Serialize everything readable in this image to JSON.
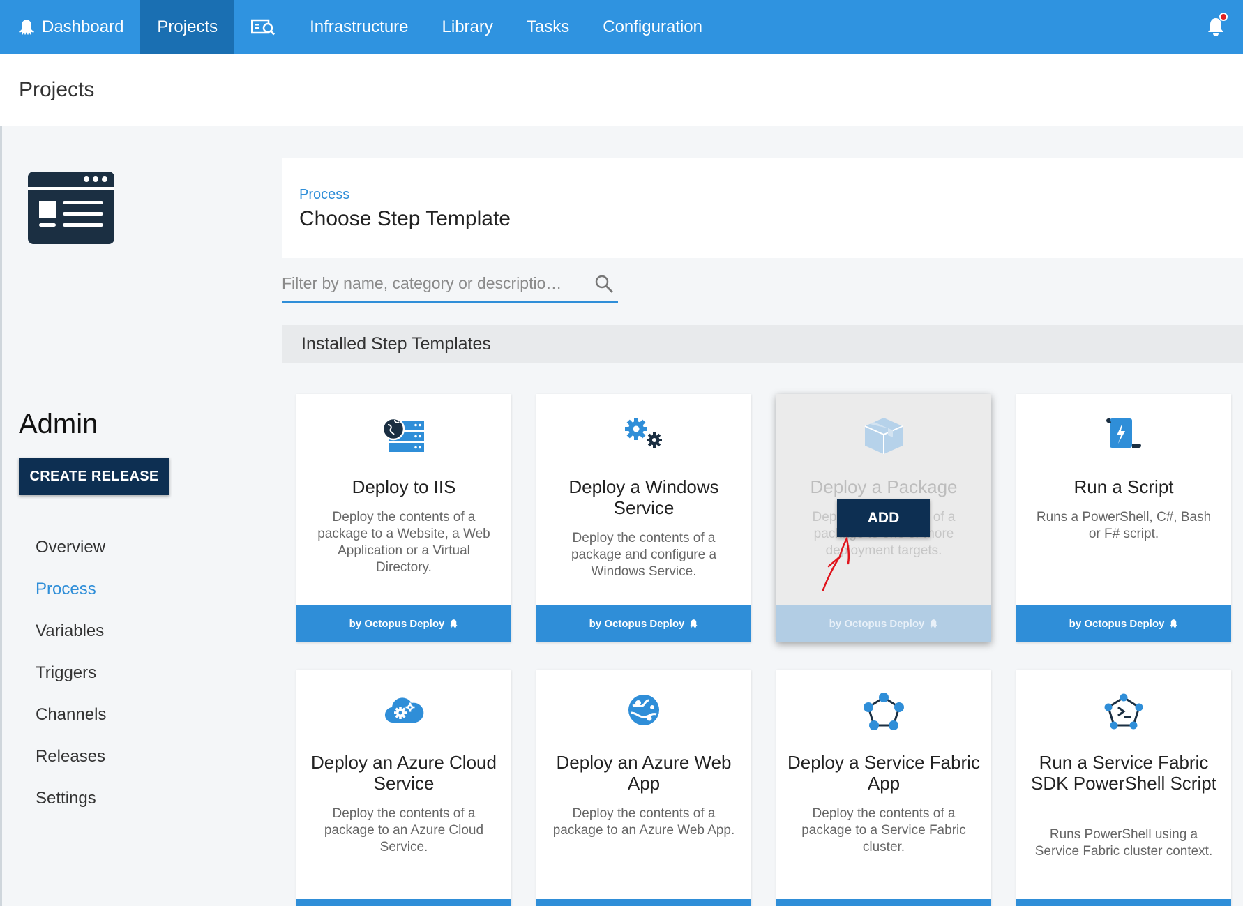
{
  "nav": {
    "brand": "Dashboard",
    "items": [
      "Projects",
      "Infrastructure",
      "Library",
      "Tasks",
      "Configuration"
    ],
    "active": "Projects"
  },
  "header": {
    "title": "Projects"
  },
  "project": {
    "name": "Admin",
    "create_release": "CREATE RELEASE"
  },
  "sidebar": {
    "items": [
      "Overview",
      "Process",
      "Variables",
      "Triggers",
      "Channels",
      "Releases",
      "Settings"
    ],
    "active": "Process"
  },
  "main": {
    "breadcrumb": "Process",
    "title": "Choose Step Template",
    "filter_placeholder": "Filter by name, category or descriptio…",
    "section_title": "Installed Step Templates",
    "add_label": "ADD",
    "footer_text": "by Octopus Deploy"
  },
  "cards": [
    {
      "title": "Deploy to IIS",
      "desc": "Deploy the contents of a package to a Website, a Web Application or a Virtual Directory.",
      "icon": "iis-server-icon"
    },
    {
      "title": "Deploy a Windows Service",
      "desc": "Deploy the contents of a package and configure a Windows Service.",
      "icon": "gears-icon"
    },
    {
      "title": "Deploy a Package",
      "desc": "Deploy the contents of a package to one or more deployment targets.",
      "icon": "package-box-icon",
      "hovered": true
    },
    {
      "title": "Run a Script",
      "desc": "Runs a PowerShell, C#, Bash or F# script.",
      "icon": "script-scroll-icon"
    },
    {
      "title": "Deploy an Azure Cloud Service",
      "desc": "Deploy the contents of a package to an Azure Cloud Service.",
      "icon": "azure-cloud-gears-icon"
    },
    {
      "title": "Deploy an Azure Web App",
      "desc": "Deploy the contents of a package to an Azure Web App.",
      "icon": "azure-globe-icon"
    },
    {
      "title": "Deploy a Service Fabric App",
      "desc": "Deploy the contents of a package to a Service Fabric cluster.",
      "icon": "service-fabric-icon"
    },
    {
      "title": "Run a Service Fabric SDK PowerShell Script",
      "desc": "Runs PowerShell using a Service Fabric cluster context.",
      "icon": "service-fabric-powershell-icon"
    }
  ],
  "colors": {
    "nav": "#2f93e0",
    "nav_active": "#1a6fb2",
    "accent": "#2f8ed8",
    "dark_button": "#0d2f52"
  }
}
